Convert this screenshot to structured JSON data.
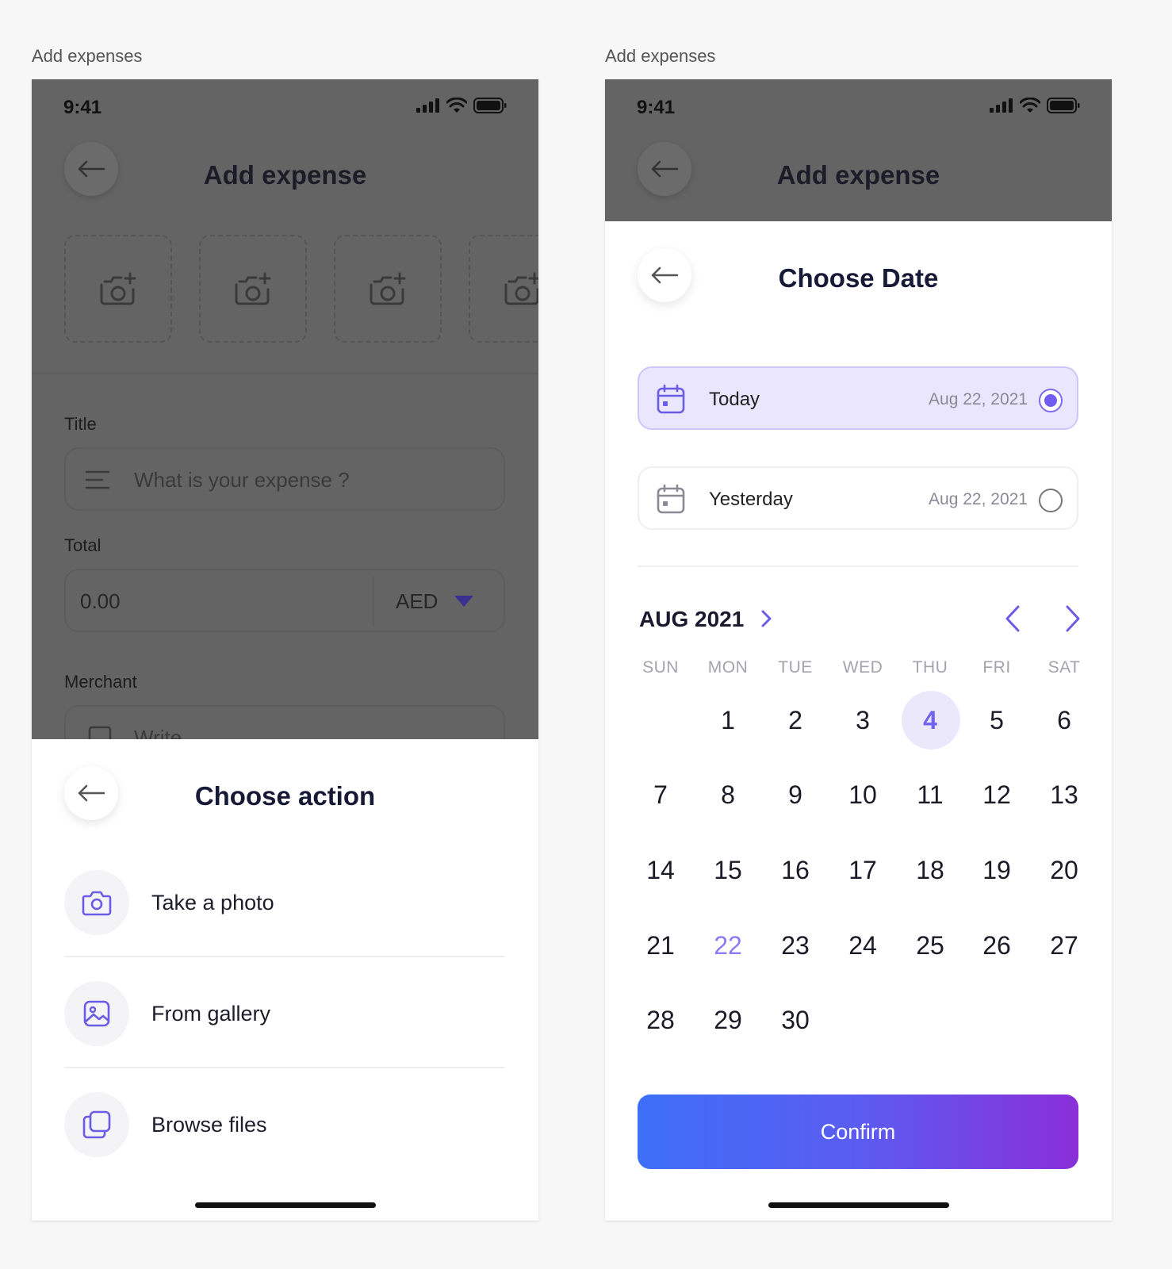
{
  "frames": [
    "Add expenses",
    "Add expenses"
  ],
  "status": {
    "time": "9:41"
  },
  "left": {
    "header_title": "Add expense",
    "title_label": "Title",
    "title_placeholder": "What is your expense ?",
    "total_label": "Total",
    "total_value": "0.00",
    "currency": "AED",
    "merchant_label": "Merchant",
    "merchant_placeholder": "Write",
    "sheet_title": "Choose action",
    "actions": [
      {
        "label": "Take a photo",
        "icon": "camera-icon"
      },
      {
        "label": "From gallery",
        "icon": "image-icon"
      },
      {
        "label": "Browse files",
        "icon": "files-icon"
      }
    ]
  },
  "right": {
    "header_title": "Add expense",
    "sheet_title": "Choose Date",
    "options": [
      {
        "label": "Today",
        "date": "Aug 22, 2021",
        "selected": true
      },
      {
        "label": "Yesterday",
        "date": "Aug 22, 2021",
        "selected": false
      }
    ],
    "month": "AUG 2021",
    "weekdays": [
      "SUN",
      "MON",
      "TUE",
      "WED",
      "THU",
      "FRI",
      "SAT"
    ],
    "days": [
      [
        "",
        "1",
        "2",
        "3",
        "4",
        "5",
        "6"
      ],
      [
        "7",
        "8",
        "9",
        "10",
        "11",
        "12",
        "13"
      ],
      [
        "14",
        "15",
        "16",
        "17",
        "18",
        "19",
        "20"
      ],
      [
        "21",
        "22",
        "23",
        "24",
        "25",
        "26",
        "27"
      ],
      [
        "28",
        "29",
        "30",
        "",
        "",
        "",
        ""
      ]
    ],
    "selected_day": "4",
    "today_day": "22",
    "confirm": "Confirm"
  },
  "colors": {
    "accent": "#6f5cf1",
    "overlay": "#646464",
    "gradient_start": "#3d6ff7",
    "gradient_end": "#8a2fd8"
  }
}
